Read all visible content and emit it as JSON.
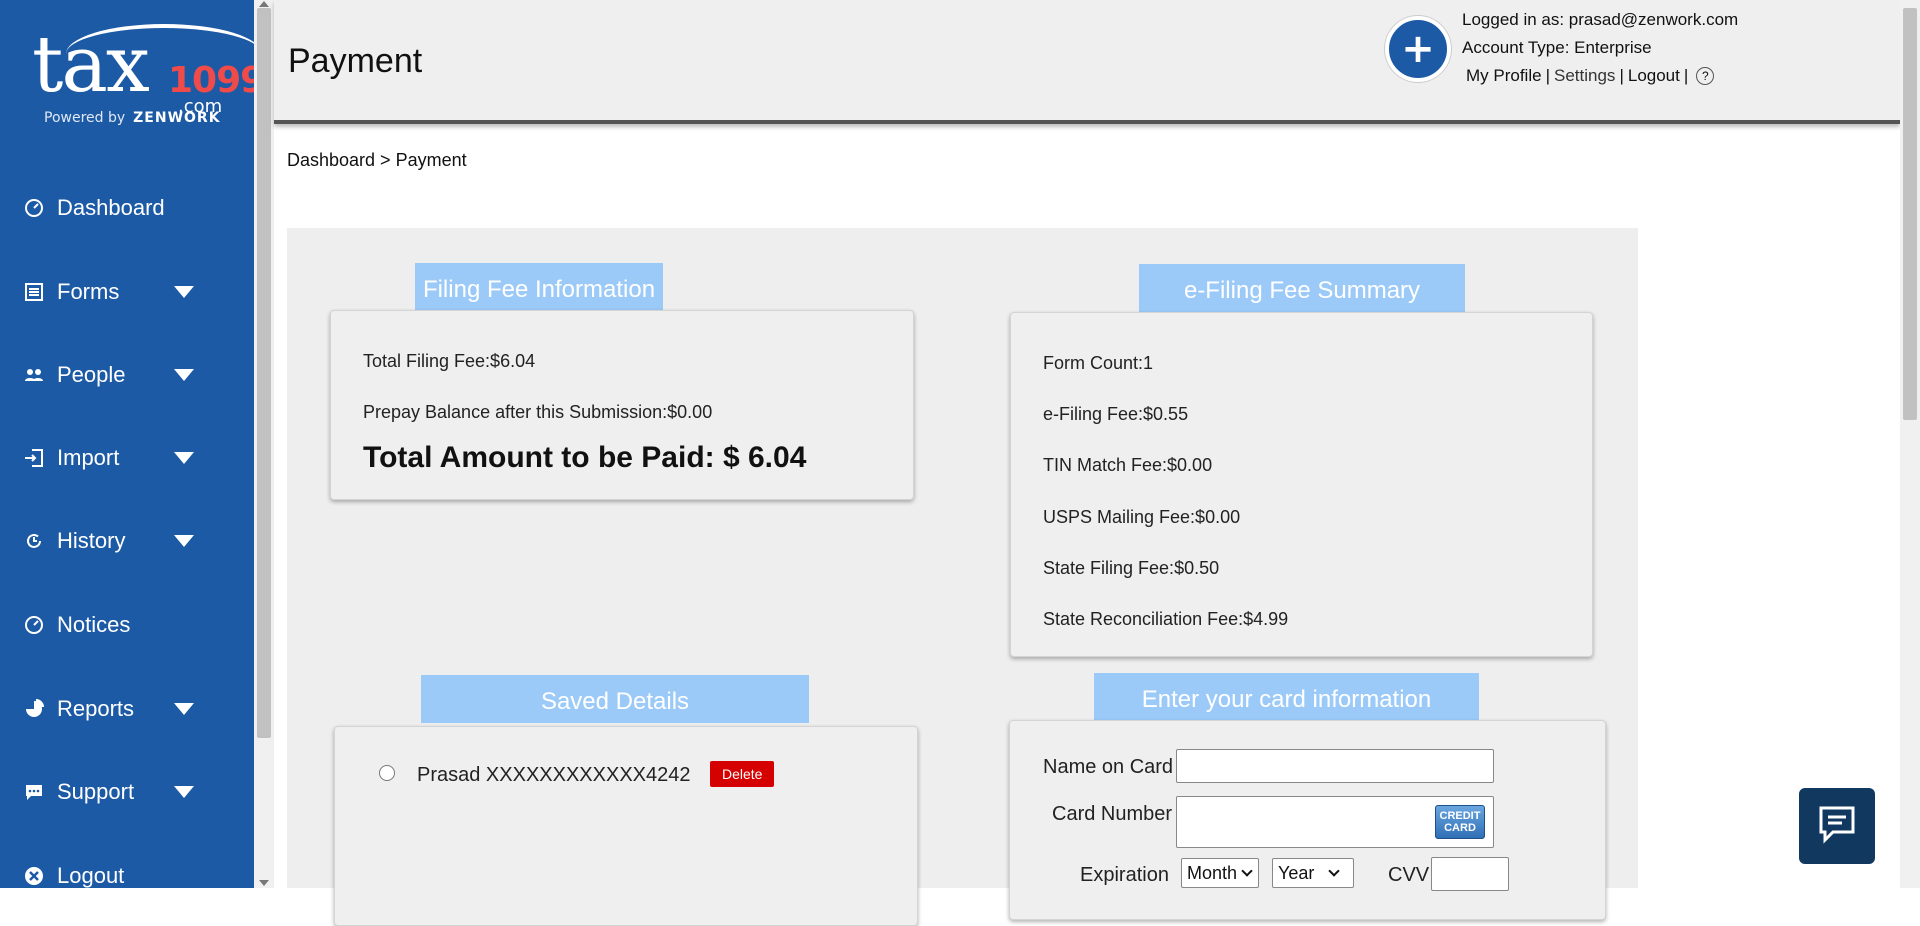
{
  "brand": {
    "logo_main": "tax",
    "logo_number": "1099",
    "logo_suffix": ".com",
    "powered_by": "Powered by",
    "powered_brand": "ZENWORK"
  },
  "sidebar": {
    "items": [
      {
        "label": "Dashboard",
        "icon": "dashboard-icon"
      },
      {
        "label": "Forms",
        "icon": "forms-icon"
      },
      {
        "label": "People",
        "icon": "people-icon"
      },
      {
        "label": "Import",
        "icon": "import-icon"
      },
      {
        "label": "History",
        "icon": "history-icon"
      },
      {
        "label": "Notices",
        "icon": "notices-icon"
      },
      {
        "label": "Reports",
        "icon": "reports-icon"
      },
      {
        "label": "Support",
        "icon": "support-icon"
      },
      {
        "label": "Logout",
        "icon": "logout-icon"
      }
    ]
  },
  "header": {
    "title": "Payment",
    "logged_in": "Logged in as: prasad@zenwork.com",
    "account_type": "Account Type: Enterprise",
    "my_profile": "My Profile",
    "settings": "Settings",
    "logout": "Logout",
    "sep": "|",
    "help": "?",
    "plus": "+"
  },
  "breadcrumb": "Dashboard > Payment",
  "filing_fee": {
    "heading": "Filing Fee Information",
    "total_filing_fee": "Total Filing Fee:$6.04",
    "prepay_balance": "Prepay Balance after this Submission:$0.00",
    "total_amount": "Total Amount to be Paid: $ 6.04"
  },
  "efiling_summary": {
    "heading": "e-Filing Fee Summary",
    "lines": [
      "Form Count:1",
      "e-Filing Fee:$0.55",
      "TIN Match Fee:$0.00",
      "USPS Mailing Fee:$0.00",
      "State Filing Fee:$0.50",
      "State Reconciliation Fee:$4.99"
    ]
  },
  "saved_details": {
    "heading": "Saved Details",
    "card_label": "Prasad XXXXXXXXXXXX4242",
    "delete_label": "Delete"
  },
  "card_info": {
    "heading": "Enter your card information",
    "name_label": "Name on Card",
    "number_label": "Card Number",
    "credit_card_badge": "CREDIT CARD",
    "expiration_label": "Expiration",
    "month_value": "Month",
    "year_value": "Year",
    "cvv_label": "CVV",
    "name_value": "",
    "number_value": "",
    "cvv_value": ""
  },
  "colors": {
    "sidebar": "#1d5aa6",
    "tab_head": "#9ccaf8",
    "delete": "#d50000",
    "chat": "#11395f"
  }
}
